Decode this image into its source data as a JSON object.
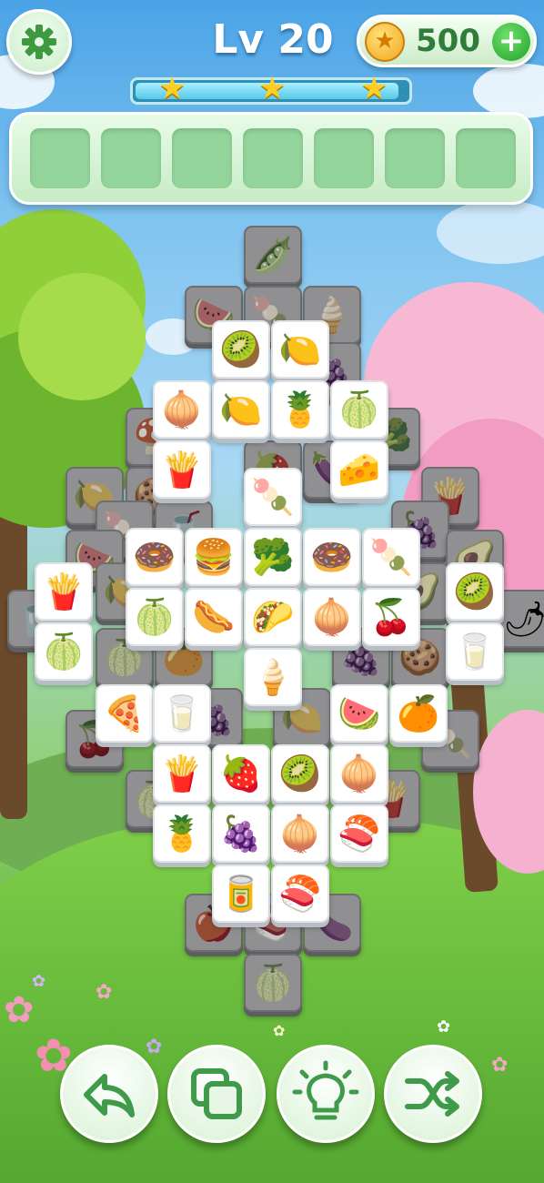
{
  "header": {
    "level_label": "Lv 20",
    "coins": "500",
    "progress_fraction": 0.97,
    "stars_earned": 3
  },
  "tray": {
    "slot_count": 7,
    "filled": 0
  },
  "icons": {
    "settings": "gear-icon",
    "coin": "coin-icon",
    "add_coins": "plus-icon",
    "undo": "undo-arrow-icon",
    "return": "stacked-squares-icon",
    "hint": "lightbulb-icon",
    "shuffle": "shuffle-icon"
  },
  "colors": {
    "accent_green": "#2e7d3a",
    "tray_bg": "#d5f2d3",
    "slot": "#92d49a"
  },
  "board": {
    "top_tiles": [
      {
        "item": "kiwi",
        "glyph": "🥝"
      },
      {
        "item": "lemon",
        "glyph": "🍋"
      },
      {
        "item": "onion",
        "glyph": "🧅"
      },
      {
        "item": "lemon",
        "glyph": "🍋"
      },
      {
        "item": "pineapple",
        "glyph": "🍍"
      },
      {
        "item": "coconut",
        "glyph": "🍈"
      },
      {
        "item": "fries",
        "glyph": "🍟"
      },
      {
        "item": "cheese",
        "glyph": "🧀"
      },
      {
        "item": "popsicle",
        "glyph": "🍡"
      },
      {
        "item": "donut",
        "glyph": "🍩"
      },
      {
        "item": "burger",
        "glyph": "🍔"
      },
      {
        "item": "broccoli",
        "glyph": "🥦"
      },
      {
        "item": "donut",
        "glyph": "🍩"
      },
      {
        "item": "popsicle",
        "glyph": "🍡"
      },
      {
        "item": "fries",
        "glyph": "🍟"
      },
      {
        "item": "kiwi",
        "glyph": "🥝"
      },
      {
        "item": "melon",
        "glyph": "🍈"
      },
      {
        "item": "hotdog",
        "glyph": "🌭"
      },
      {
        "item": "taco",
        "glyph": "🌮"
      },
      {
        "item": "onion",
        "glyph": "🧅"
      },
      {
        "item": "cherries",
        "glyph": "🍒"
      },
      {
        "item": "melon",
        "glyph": "🍈"
      },
      {
        "item": "milk",
        "glyph": "🥛"
      },
      {
        "item": "ice-cream",
        "glyph": "🍦"
      },
      {
        "item": "pizza",
        "glyph": "🍕"
      },
      {
        "item": "milk",
        "glyph": "🥛"
      },
      {
        "item": "watermelon",
        "glyph": "🍉"
      },
      {
        "item": "orange",
        "glyph": "🍊"
      },
      {
        "item": "fries",
        "glyph": "🍟"
      },
      {
        "item": "strawberry",
        "glyph": "🍓"
      },
      {
        "item": "kiwi",
        "glyph": "🥝"
      },
      {
        "item": "onion",
        "glyph": "🧅"
      },
      {
        "item": "pineapple",
        "glyph": "🍍"
      },
      {
        "item": "grapes",
        "glyph": "🍇"
      },
      {
        "item": "onion",
        "glyph": "🧅"
      },
      {
        "item": "sushi",
        "glyph": "🍣"
      },
      {
        "item": "soda-can",
        "glyph": "🥫"
      },
      {
        "item": "sushi",
        "glyph": "🍣"
      }
    ],
    "low_tiles": [
      {
        "item": "pea-pod",
        "glyph": "🫛"
      },
      {
        "item": "watermelon",
        "glyph": "🍉"
      },
      {
        "item": "popsicle",
        "glyph": "🍡"
      },
      {
        "item": "ice-cream",
        "glyph": "🍦"
      },
      {
        "item": "grapes",
        "glyph": "🍇"
      },
      {
        "item": "mushroom",
        "glyph": "🍄"
      },
      {
        "item": "broccoli",
        "glyph": "🥦"
      },
      {
        "item": "strawberry",
        "glyph": "🍓"
      },
      {
        "item": "eggplant",
        "glyph": "🍆"
      },
      {
        "item": "lemon",
        "glyph": "🍋"
      },
      {
        "item": "cookie",
        "glyph": "🍪"
      },
      {
        "item": "fries",
        "glyph": "🍟"
      },
      {
        "item": "popsicle",
        "glyph": "🍡"
      },
      {
        "item": "soda",
        "glyph": "🥤"
      },
      {
        "item": "mangosteen",
        "glyph": "🍇"
      },
      {
        "item": "watermelon",
        "glyph": "🍉"
      },
      {
        "item": "avocado",
        "glyph": "🥑"
      },
      {
        "item": "lemon",
        "glyph": "🍋"
      },
      {
        "item": "avocado",
        "glyph": "🥑"
      },
      {
        "item": "chili",
        "glyph": "🌶"
      },
      {
        "item": "soda",
        "glyph": "🥤"
      },
      {
        "item": "melon",
        "glyph": "🍈"
      },
      {
        "item": "cookie",
        "glyph": "🍪"
      },
      {
        "item": "grapes",
        "glyph": "🍇"
      },
      {
        "item": "orange",
        "glyph": "🍊"
      },
      {
        "item": "mangosteen",
        "glyph": "🍇"
      },
      {
        "item": "lemon",
        "glyph": "🍋"
      },
      {
        "item": "cherries",
        "glyph": "🍒"
      },
      {
        "item": "popsicle",
        "glyph": "🍡"
      },
      {
        "item": "melon",
        "glyph": "🍈"
      },
      {
        "item": "fries",
        "glyph": "🍟"
      },
      {
        "item": "apple",
        "glyph": "🍎"
      },
      {
        "item": "sushi",
        "glyph": "🍣"
      },
      {
        "item": "eggplant",
        "glyph": "🍆"
      },
      {
        "item": "melon",
        "glyph": "🍈"
      }
    ]
  }
}
